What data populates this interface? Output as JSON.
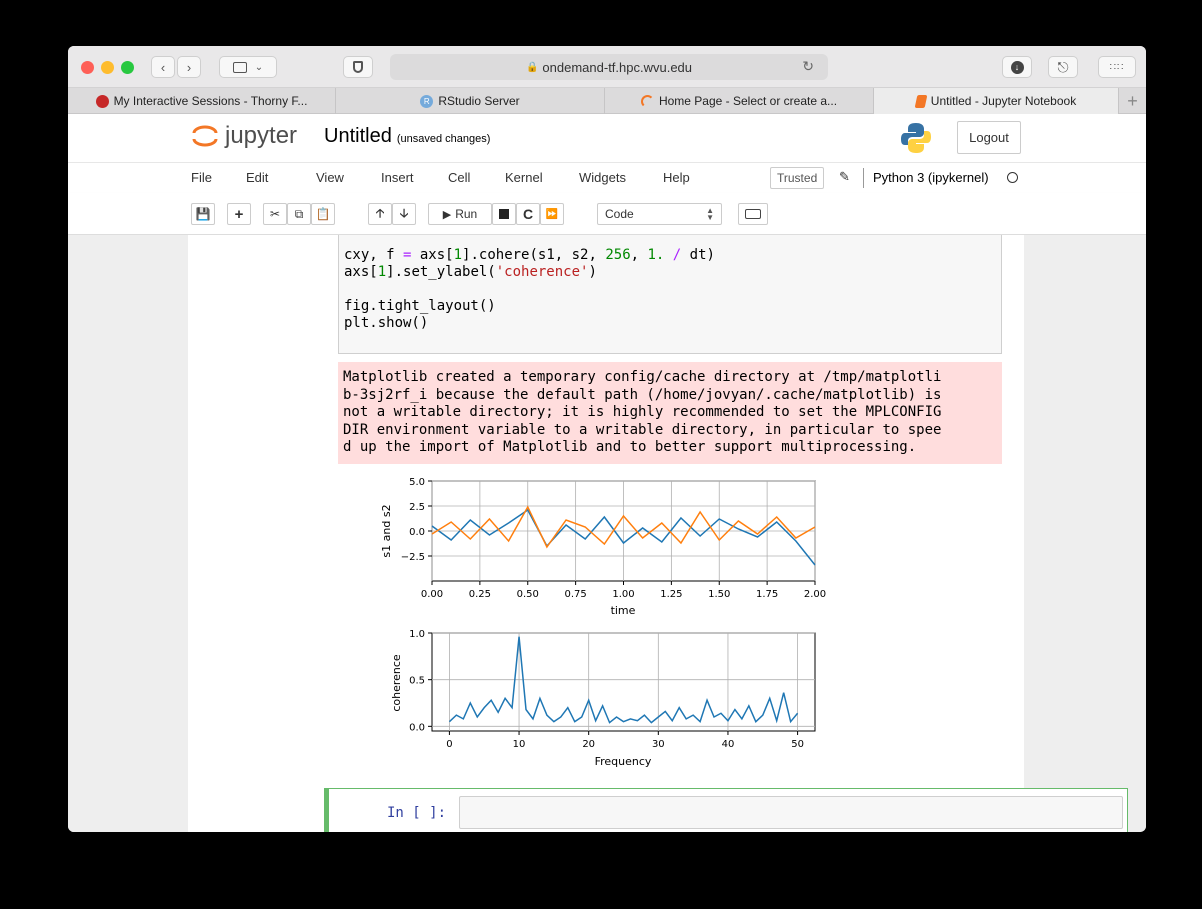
{
  "browser": {
    "url": "ondemand-tf.hpc.wvu.edu",
    "tabs": [
      {
        "label": "My Interactive Sessions - Thorny F...",
        "icon": "ondemand-icon",
        "active": false
      },
      {
        "label": "RStudio Server",
        "icon": "rstudio-icon",
        "active": false
      },
      {
        "label": "Home Page - Select or create a...",
        "icon": "jupyter-spinner-icon",
        "active": false
      },
      {
        "label": "Untitled - Jupyter Notebook",
        "icon": "notebook-icon",
        "active": true
      }
    ],
    "new_tab": "+"
  },
  "header": {
    "logo_text": "jupyter",
    "notebook_title": "Untitled",
    "save_status": "(unsaved changes)",
    "logout_label": "Logout"
  },
  "menubar": {
    "items": [
      "File",
      "Edit",
      "View",
      "Insert",
      "Cell",
      "Kernel",
      "Widgets",
      "Help"
    ],
    "trusted": "Trusted",
    "kernel_name": "Python 3 (ipykernel)"
  },
  "toolbar": {
    "run_label": "Run",
    "cell_type": "Code"
  },
  "code_cell": {
    "lines": [
      "cxy, f = axs[1].cohere(s1, s2, 256, 1. / dt)",
      "axs[1].set_ylabel('coherence')",
      "",
      "fig.tight_layout()",
      "plt.show()"
    ]
  },
  "stderr_output": {
    "lines": [
      "Matplotlib created a temporary config/cache directory at /tmp/matplotli",
      "b-3sj2rf_i because the default path (/home/jovyan/.cache/matplotlib) is",
      "not a writable directory; it is highly recommended to set the MPLCONFIG",
      "DIR environment variable to a writable directory, in particular to spee",
      "d up the import of Matplotlib and to better support multiprocessing."
    ]
  },
  "plot1": {
    "ylabel": "s1 and s2",
    "xlabel": "time",
    "yticks": [
      "5.0",
      "2.5",
      "0.0",
      "−2.5"
    ],
    "xticks": [
      "0.00",
      "0.25",
      "0.50",
      "0.75",
      "1.00",
      "1.25",
      "1.50",
      "1.75",
      "2.00"
    ],
    "series_colors": [
      "#1f77b4",
      "#ff7f0e"
    ]
  },
  "plot2": {
    "ylabel": "coherence",
    "xlabel": "Frequency",
    "yticks": [
      "1.0",
      "0.5",
      "0.0"
    ],
    "xticks": [
      "0",
      "10",
      "20",
      "30",
      "40",
      "50"
    ],
    "line_color": "#1f77b4"
  },
  "chart_data": [
    {
      "type": "line",
      "xlabel": "time",
      "ylabel": "s1 and s2",
      "xlim": [
        0,
        2
      ],
      "ylim": [
        -5,
        5
      ],
      "grid": true,
      "x": [
        0.0,
        0.1,
        0.2,
        0.3,
        0.4,
        0.5,
        0.6,
        0.7,
        0.8,
        0.9,
        1.0,
        1.1,
        1.2,
        1.3,
        1.4,
        1.5,
        1.6,
        1.7,
        1.8,
        1.9,
        2.0
      ],
      "series": [
        {
          "values": [
            0.5,
            -0.9,
            1.1,
            -0.4,
            0.8,
            2.1,
            -1.5,
            0.6,
            -0.8,
            1.4,
            -1.2,
            0.3,
            -1.1,
            1.3,
            -0.5,
            1.2,
            0.2,
            -0.6,
            0.9,
            -1.0,
            -3.4
          ]
        },
        {
          "values": [
            -0.3,
            0.9,
            -0.8,
            1.2,
            -1.0,
            2.4,
            -1.6,
            1.1,
            0.4,
            -1.3,
            1.5,
            -0.7,
            0.8,
            -1.2,
            1.9,
            -0.9,
            1.0,
            -0.3,
            1.4,
            -0.7,
            0.4
          ]
        }
      ]
    },
    {
      "type": "line",
      "xlabel": "Frequency",
      "ylabel": "coherence",
      "xlim": [
        -2.5,
        52.5
      ],
      "ylim": [
        -0.05,
        1.0
      ],
      "grid": true,
      "x": [
        0,
        1,
        2,
        3,
        4,
        5,
        6,
        7,
        8,
        9,
        10,
        11,
        12,
        13,
        14,
        15,
        16,
        17,
        18,
        19,
        20,
        21,
        22,
        23,
        24,
        25,
        26,
        27,
        28,
        29,
        30,
        31,
        32,
        33,
        34,
        35,
        36,
        37,
        38,
        39,
        40,
        41,
        42,
        43,
        44,
        45,
        46,
        47,
        48,
        49,
        50
      ],
      "values": [
        0.05,
        0.12,
        0.08,
        0.25,
        0.1,
        0.2,
        0.28,
        0.15,
        0.3,
        0.2,
        0.96,
        0.18,
        0.08,
        0.3,
        0.12,
        0.05,
        0.1,
        0.2,
        0.05,
        0.1,
        0.28,
        0.06,
        0.22,
        0.04,
        0.1,
        0.05,
        0.08,
        0.06,
        0.12,
        0.04,
        0.1,
        0.16,
        0.06,
        0.2,
        0.08,
        0.12,
        0.05,
        0.28,
        0.1,
        0.14,
        0.06,
        0.18,
        0.08,
        0.22,
        0.05,
        0.12,
        0.3,
        0.06,
        0.36,
        0.05,
        0.14
      ]
    }
  ],
  "new_cell": {
    "prompt": "In [ ]:"
  }
}
